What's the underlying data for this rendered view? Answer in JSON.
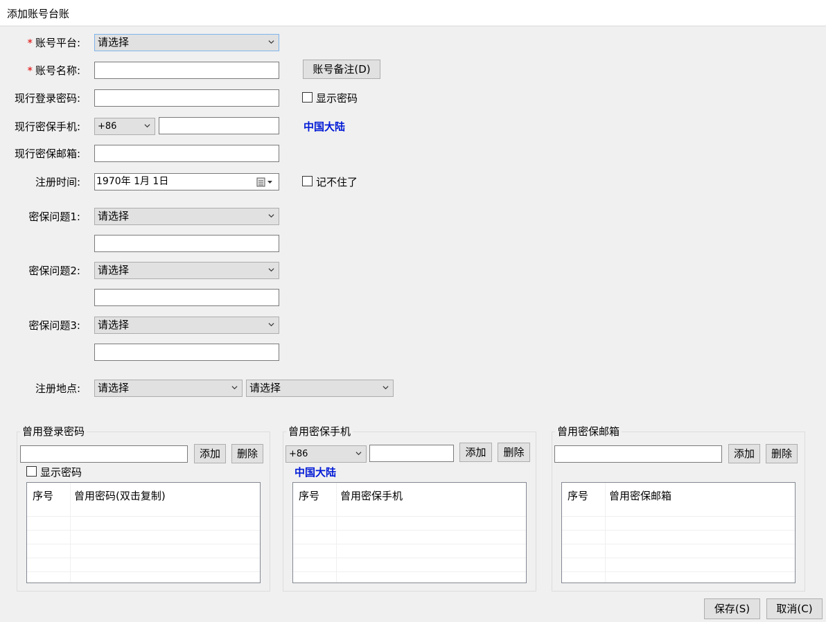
{
  "window": {
    "title": "添加账号台账"
  },
  "form": {
    "platform_label": "账号平台:",
    "platform_value": "请选择",
    "account_name_label": "账号名称:",
    "account_note_button": "账号备注(D)",
    "password_label": "现行登录密码:",
    "show_password_label": "显示密码",
    "phone_label": "现行密保手机:",
    "phone_code": "+86",
    "phone_region": "中国大陆",
    "email_label": "现行密保邮箱:",
    "reg_time_label": "注册时间:",
    "reg_time_value": "1970年  1月  1日",
    "forgot_label": "记不住了",
    "q1_label": "密保问题1:",
    "q1_value": "请选择",
    "q2_label": "密保问题2:",
    "q2_value": "请选择",
    "q3_label": "密保问题3:",
    "q3_value": "请选择",
    "reg_place_label": "注册地点:",
    "reg_place_value1": "请选择",
    "reg_place_value2": "请选择"
  },
  "groups": {
    "old_passwords": {
      "title": "曾用登录密码",
      "add": "添加",
      "delete": "删除",
      "show_password": "显示密码",
      "columns": [
        "序号",
        "曾用密码(双击复制)"
      ]
    },
    "old_phones": {
      "title": "曾用密保手机",
      "code": "+86",
      "add": "添加",
      "delete": "删除",
      "region": "中国大陆",
      "columns": [
        "序号",
        "曾用密保手机"
      ]
    },
    "old_emails": {
      "title": "曾用密保邮箱",
      "add": "添加",
      "delete": "删除",
      "columns": [
        "序号",
        "曾用密保邮箱"
      ]
    }
  },
  "footer": {
    "save": "保存(S)",
    "cancel": "取消(C)"
  },
  "colors": {
    "required": "#e00000",
    "region_link": "#0019d6",
    "background": "#f0f0f0"
  }
}
